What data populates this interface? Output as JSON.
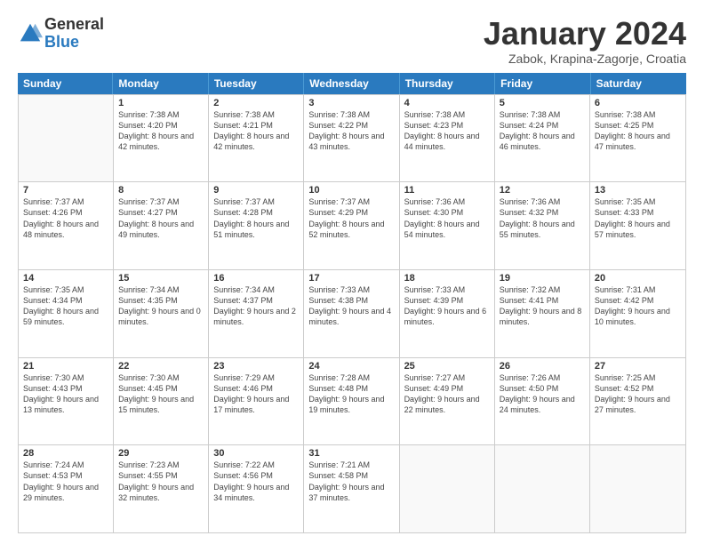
{
  "logo": {
    "general": "General",
    "blue": "Blue"
  },
  "title": "January 2024",
  "subtitle": "Zabok, Krapina-Zagorje, Croatia",
  "header_days": [
    "Sunday",
    "Monday",
    "Tuesday",
    "Wednesday",
    "Thursday",
    "Friday",
    "Saturday"
  ],
  "weeks": [
    [
      {
        "day": "",
        "sunrise": "",
        "sunset": "",
        "daylight": ""
      },
      {
        "day": "1",
        "sunrise": "Sunrise: 7:38 AM",
        "sunset": "Sunset: 4:20 PM",
        "daylight": "Daylight: 8 hours and 42 minutes."
      },
      {
        "day": "2",
        "sunrise": "Sunrise: 7:38 AM",
        "sunset": "Sunset: 4:21 PM",
        "daylight": "Daylight: 8 hours and 42 minutes."
      },
      {
        "day": "3",
        "sunrise": "Sunrise: 7:38 AM",
        "sunset": "Sunset: 4:22 PM",
        "daylight": "Daylight: 8 hours and 43 minutes."
      },
      {
        "day": "4",
        "sunrise": "Sunrise: 7:38 AM",
        "sunset": "Sunset: 4:23 PM",
        "daylight": "Daylight: 8 hours and 44 minutes."
      },
      {
        "day": "5",
        "sunrise": "Sunrise: 7:38 AM",
        "sunset": "Sunset: 4:24 PM",
        "daylight": "Daylight: 8 hours and 46 minutes."
      },
      {
        "day": "6",
        "sunrise": "Sunrise: 7:38 AM",
        "sunset": "Sunset: 4:25 PM",
        "daylight": "Daylight: 8 hours and 47 minutes."
      }
    ],
    [
      {
        "day": "7",
        "sunrise": "Sunrise: 7:37 AM",
        "sunset": "Sunset: 4:26 PM",
        "daylight": "Daylight: 8 hours and 48 minutes."
      },
      {
        "day": "8",
        "sunrise": "Sunrise: 7:37 AM",
        "sunset": "Sunset: 4:27 PM",
        "daylight": "Daylight: 8 hours and 49 minutes."
      },
      {
        "day": "9",
        "sunrise": "Sunrise: 7:37 AM",
        "sunset": "Sunset: 4:28 PM",
        "daylight": "Daylight: 8 hours and 51 minutes."
      },
      {
        "day": "10",
        "sunrise": "Sunrise: 7:37 AM",
        "sunset": "Sunset: 4:29 PM",
        "daylight": "Daylight: 8 hours and 52 minutes."
      },
      {
        "day": "11",
        "sunrise": "Sunrise: 7:36 AM",
        "sunset": "Sunset: 4:30 PM",
        "daylight": "Daylight: 8 hours and 54 minutes."
      },
      {
        "day": "12",
        "sunrise": "Sunrise: 7:36 AM",
        "sunset": "Sunset: 4:32 PM",
        "daylight": "Daylight: 8 hours and 55 minutes."
      },
      {
        "day": "13",
        "sunrise": "Sunrise: 7:35 AM",
        "sunset": "Sunset: 4:33 PM",
        "daylight": "Daylight: 8 hours and 57 minutes."
      }
    ],
    [
      {
        "day": "14",
        "sunrise": "Sunrise: 7:35 AM",
        "sunset": "Sunset: 4:34 PM",
        "daylight": "Daylight: 8 hours and 59 minutes."
      },
      {
        "day": "15",
        "sunrise": "Sunrise: 7:34 AM",
        "sunset": "Sunset: 4:35 PM",
        "daylight": "Daylight: 9 hours and 0 minutes."
      },
      {
        "day": "16",
        "sunrise": "Sunrise: 7:34 AM",
        "sunset": "Sunset: 4:37 PM",
        "daylight": "Daylight: 9 hours and 2 minutes."
      },
      {
        "day": "17",
        "sunrise": "Sunrise: 7:33 AM",
        "sunset": "Sunset: 4:38 PM",
        "daylight": "Daylight: 9 hours and 4 minutes."
      },
      {
        "day": "18",
        "sunrise": "Sunrise: 7:33 AM",
        "sunset": "Sunset: 4:39 PM",
        "daylight": "Daylight: 9 hours and 6 minutes."
      },
      {
        "day": "19",
        "sunrise": "Sunrise: 7:32 AM",
        "sunset": "Sunset: 4:41 PM",
        "daylight": "Daylight: 9 hours and 8 minutes."
      },
      {
        "day": "20",
        "sunrise": "Sunrise: 7:31 AM",
        "sunset": "Sunset: 4:42 PM",
        "daylight": "Daylight: 9 hours and 10 minutes."
      }
    ],
    [
      {
        "day": "21",
        "sunrise": "Sunrise: 7:30 AM",
        "sunset": "Sunset: 4:43 PM",
        "daylight": "Daylight: 9 hours and 13 minutes."
      },
      {
        "day": "22",
        "sunrise": "Sunrise: 7:30 AM",
        "sunset": "Sunset: 4:45 PM",
        "daylight": "Daylight: 9 hours and 15 minutes."
      },
      {
        "day": "23",
        "sunrise": "Sunrise: 7:29 AM",
        "sunset": "Sunset: 4:46 PM",
        "daylight": "Daylight: 9 hours and 17 minutes."
      },
      {
        "day": "24",
        "sunrise": "Sunrise: 7:28 AM",
        "sunset": "Sunset: 4:48 PM",
        "daylight": "Daylight: 9 hours and 19 minutes."
      },
      {
        "day": "25",
        "sunrise": "Sunrise: 7:27 AM",
        "sunset": "Sunset: 4:49 PM",
        "daylight": "Daylight: 9 hours and 22 minutes."
      },
      {
        "day": "26",
        "sunrise": "Sunrise: 7:26 AM",
        "sunset": "Sunset: 4:50 PM",
        "daylight": "Daylight: 9 hours and 24 minutes."
      },
      {
        "day": "27",
        "sunrise": "Sunrise: 7:25 AM",
        "sunset": "Sunset: 4:52 PM",
        "daylight": "Daylight: 9 hours and 27 minutes."
      }
    ],
    [
      {
        "day": "28",
        "sunrise": "Sunrise: 7:24 AM",
        "sunset": "Sunset: 4:53 PM",
        "daylight": "Daylight: 9 hours and 29 minutes."
      },
      {
        "day": "29",
        "sunrise": "Sunrise: 7:23 AM",
        "sunset": "Sunset: 4:55 PM",
        "daylight": "Daylight: 9 hours and 32 minutes."
      },
      {
        "day": "30",
        "sunrise": "Sunrise: 7:22 AM",
        "sunset": "Sunset: 4:56 PM",
        "daylight": "Daylight: 9 hours and 34 minutes."
      },
      {
        "day": "31",
        "sunrise": "Sunrise: 7:21 AM",
        "sunset": "Sunset: 4:58 PM",
        "daylight": "Daylight: 9 hours and 37 minutes."
      },
      {
        "day": "",
        "sunrise": "",
        "sunset": "",
        "daylight": ""
      },
      {
        "day": "",
        "sunrise": "",
        "sunset": "",
        "daylight": ""
      },
      {
        "day": "",
        "sunrise": "",
        "sunset": "",
        "daylight": ""
      }
    ]
  ]
}
